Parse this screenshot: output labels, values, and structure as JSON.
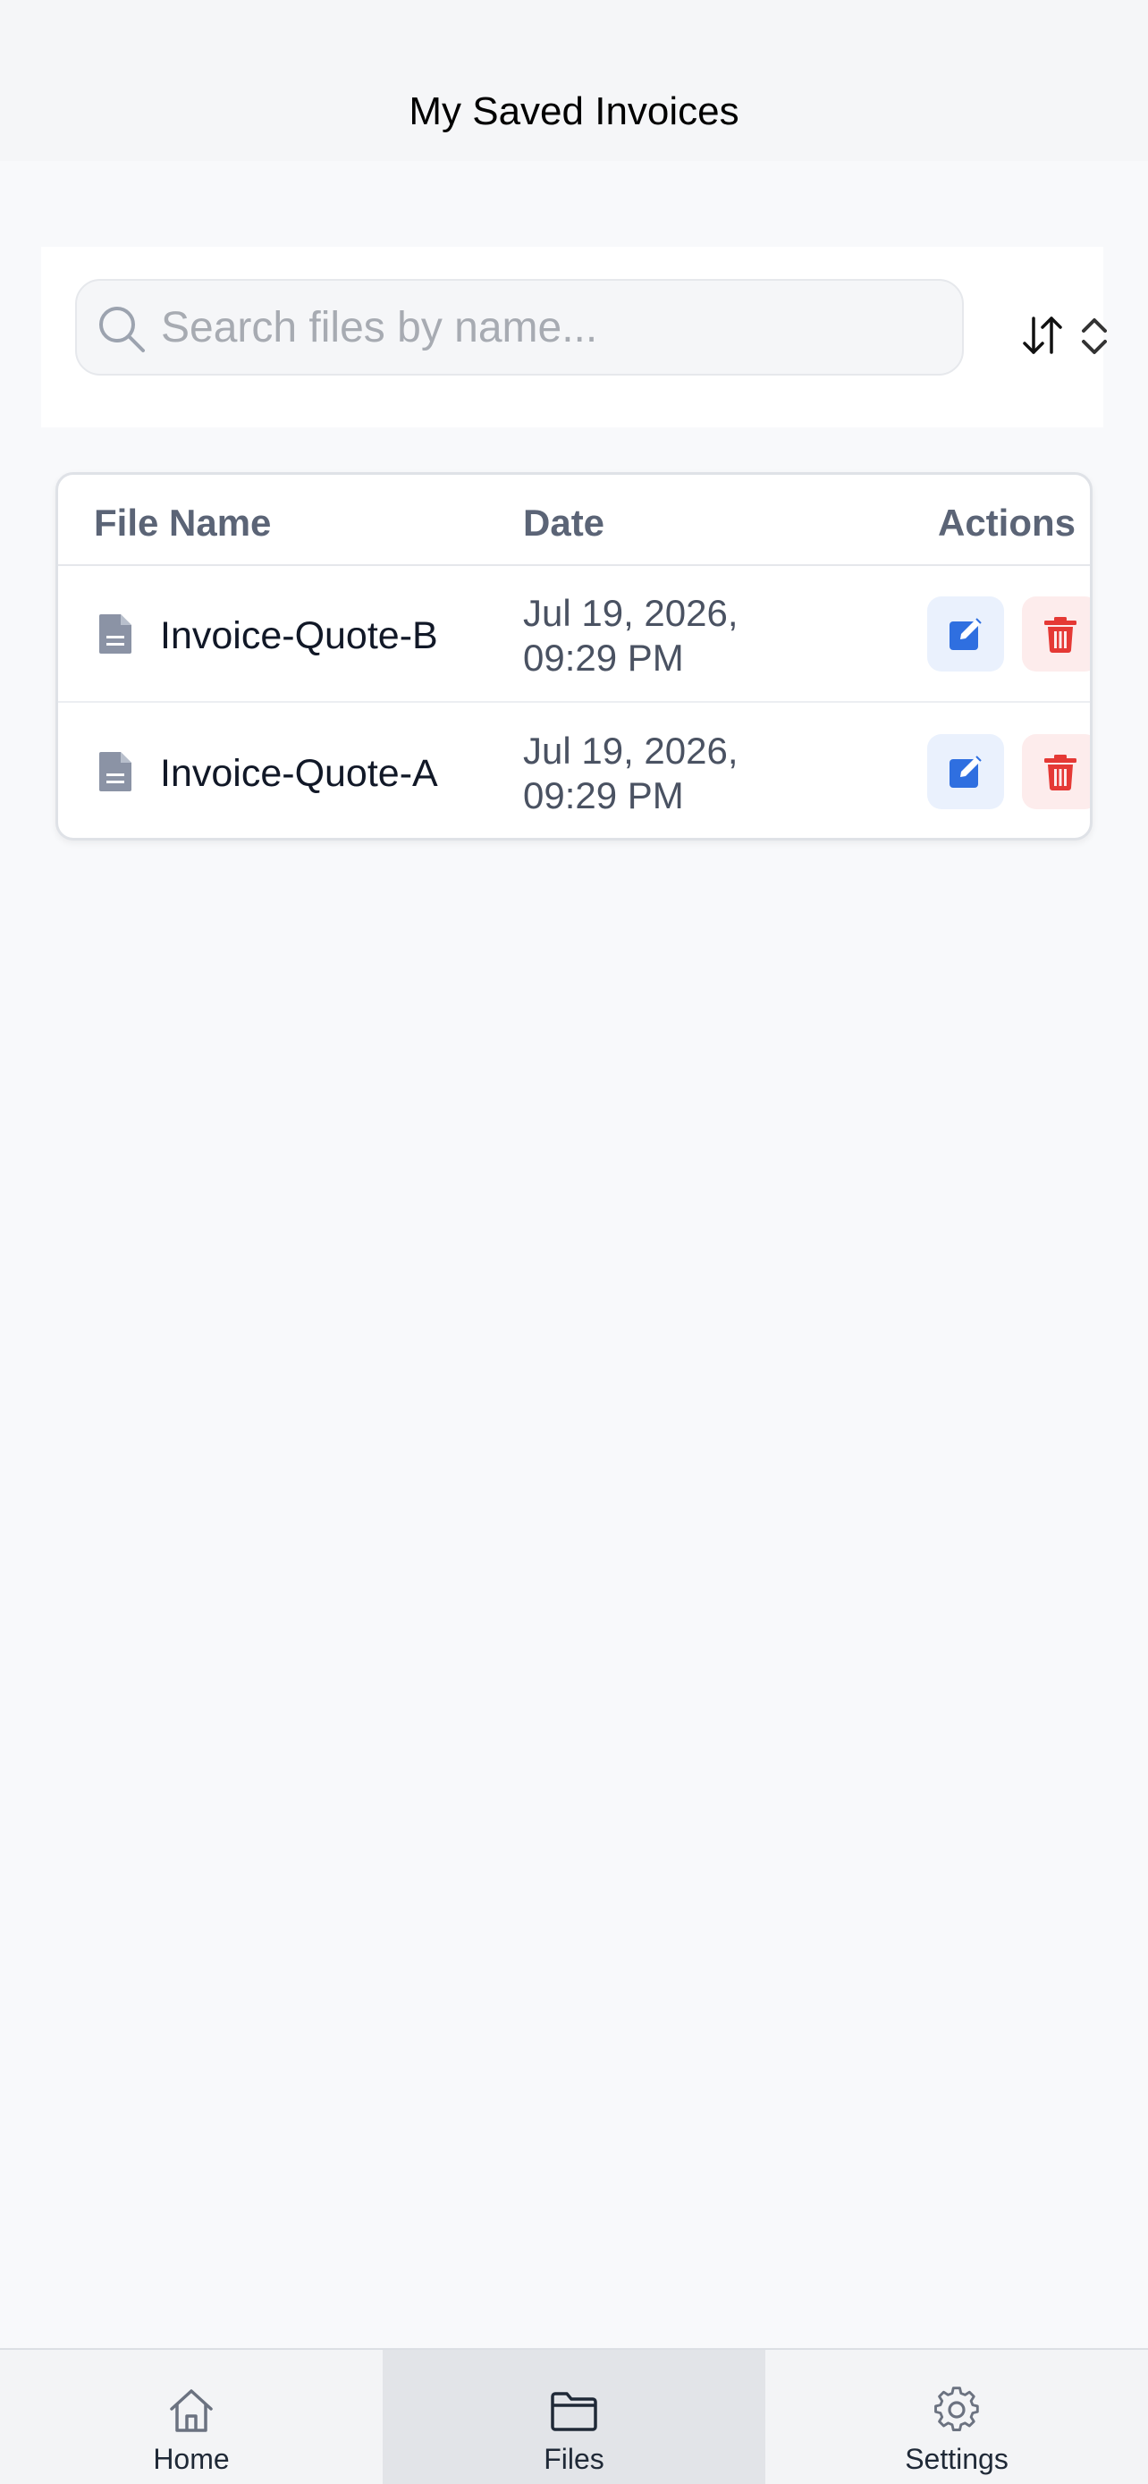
{
  "header": {
    "title": "My Saved Invoices"
  },
  "search": {
    "placeholder": "Search files by name...",
    "value": "",
    "icon": "search-icon"
  },
  "sort": {
    "icon": "sort-arrows-icon",
    "select_icon": "chevron-up-down-icon"
  },
  "table": {
    "columns": [
      "File Name",
      "Date",
      "Actions"
    ],
    "rows": [
      {
        "name": "Invoice-Quote-B",
        "date_line1": "Jul 19, 2026,",
        "date_line2": "09:29 PM"
      },
      {
        "name": "Invoice-Quote-A",
        "date_line1": "Jul 19, 2026,",
        "date_line2": "09:29 PM"
      }
    ]
  },
  "nav": {
    "items": [
      {
        "label": "Home",
        "icon": "home-icon"
      },
      {
        "label": "Files",
        "icon": "folder-icon",
        "active": true
      },
      {
        "label": "Settings",
        "icon": "gear-icon"
      }
    ]
  },
  "colors": {
    "edit": "#2f6fe0",
    "delete": "#e53935",
    "active_tab": "#e2e4e8"
  }
}
